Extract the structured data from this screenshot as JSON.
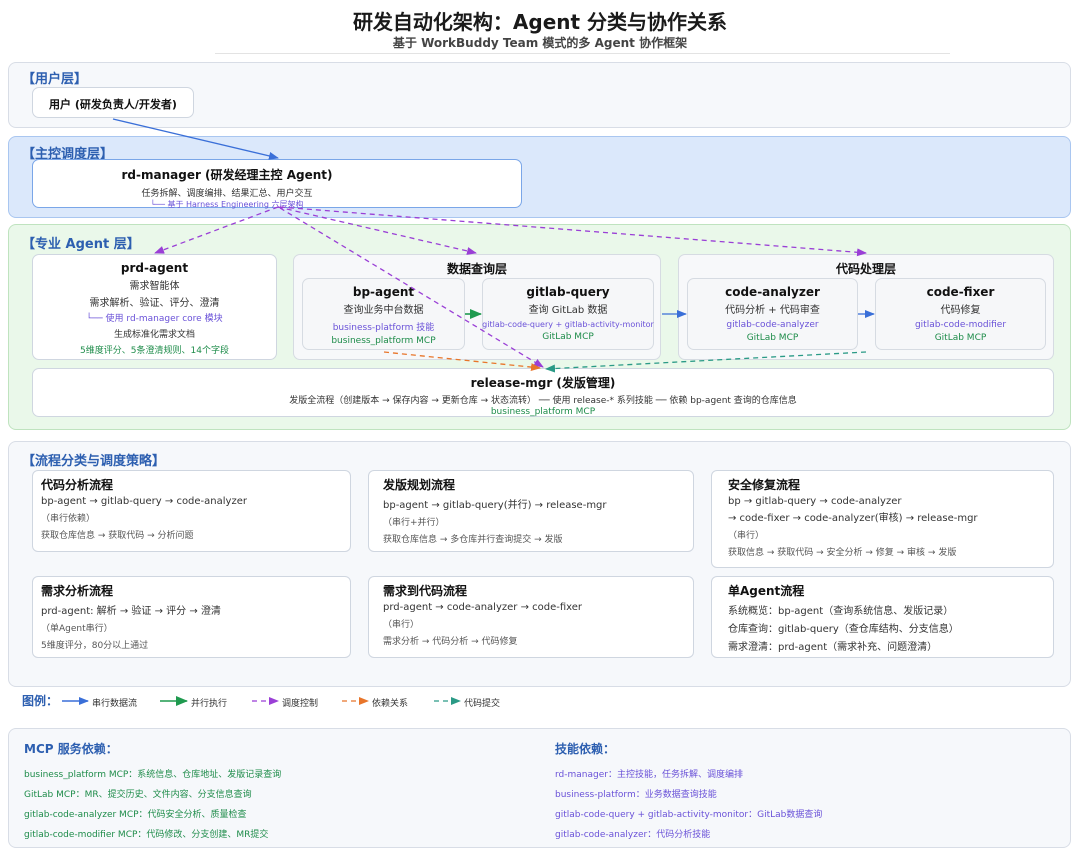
{
  "header": {
    "title": "研发自动化架构：Agent 分类与协作关系",
    "subtitle": "基于 WorkBuddy Team 模式的多 Agent 协作框架"
  },
  "user_layer": {
    "title": "【用户层】",
    "user_box": "用户 (研发负责人/开发者)"
  },
  "main_layer": {
    "title": "【主控调度层】",
    "rd_manager": {
      "name": "rd-manager (研发经理主控 Agent)",
      "desc": "任务拆解、调度编排、结果汇总、用户交互",
      "note": "└── 基于 Harness Engineering 六层架构"
    }
  },
  "agent_layer": {
    "title": "【专业 Agent 层】",
    "prd_agent": {
      "name": "prd-agent",
      "line1": "需求智能体",
      "line2": "需求解析、验证、评分、澄清",
      "line3": "└── 使用 rd-manager core 模块",
      "line4": "生成标准化需求文档",
      "line5": "5维度评分、5条澄清规则、14个字段"
    },
    "data_group": {
      "title": "数据查询层",
      "bp_agent": {
        "name": "bp-agent",
        "desc": "查询业务中台数据",
        "skill": "business-platform 技能",
        "mcp": "business_platform MCP"
      },
      "gitlab_query": {
        "name": "gitlab-query",
        "desc": "查询 GitLab 数据",
        "skill": "gitlab-code-query + gitlab-activity-monitor",
        "mcp": "GitLab MCP"
      }
    },
    "code_group": {
      "title": "代码处理层",
      "code_analyzer": {
        "name": "code-analyzer",
        "desc": "代码分析 + 代码审查",
        "skill": "gitlab-code-analyzer",
        "mcp": "GitLab MCP"
      },
      "code_fixer": {
        "name": "code-fixer",
        "desc": "代码修复",
        "skill": "gitlab-code-modifier",
        "mcp": "GitLab MCP"
      }
    },
    "release_mgr": {
      "name": "release-mgr (发版管理)",
      "desc": "发版全流程（创建版本 → 保存内容 → 更新仓库 → 状态流转） ── 使用 release-* 系列技能 ── 依赖 bp-agent 查询的仓库信息",
      "mcp": "business_platform MCP"
    }
  },
  "flow_layer": {
    "title": "【流程分类与调度策略】",
    "cards": [
      {
        "title": "代码分析流程",
        "lines": [
          "bp-agent → gitlab-query → code-analyzer"
        ],
        "mode": "（串行依赖）",
        "summary": "获取仓库信息 → 获取代码 → 分析问题"
      },
      {
        "title": "发版规划流程",
        "lines": [
          "bp-agent → gitlab-query(并行) → release-mgr"
        ],
        "mode": "（串行+并行）",
        "summary": "获取仓库信息 → 多仓库并行查询提交 → 发版"
      },
      {
        "title": "安全修复流程",
        "lines": [
          "bp → gitlab-query → code-analyzer",
          "→ code-fixer → code-analyzer(审核) → release-mgr"
        ],
        "mode": "（串行）",
        "summary": "获取信息 → 获取代码 → 安全分析 → 修复 → 审核 → 发版"
      },
      {
        "title": "需求分析流程",
        "lines": [
          "prd-agent: 解析 → 验证 → 评分 → 澄清"
        ],
        "mode": "（单Agent串行）",
        "summary": "5维度评分，80分以上通过"
      },
      {
        "title": "需求到代码流程",
        "lines": [
          "prd-agent → code-analyzer → code-fixer"
        ],
        "mode": "（串行）",
        "summary": "需求分析 → 代码分析 → 代码修复"
      },
      {
        "title": "单Agent流程",
        "lines": [
          "系统概览：bp-agent（查询系统信息、发版记录）",
          "仓库查询：gitlab-query（查仓库结构、分支信息）",
          "需求澄清：prd-agent（需求补充、问题澄清）"
        ],
        "mode": "",
        "summary": ""
      }
    ]
  },
  "legend": {
    "title": "图例：",
    "items": [
      {
        "label": "串行数据流",
        "color": "#3a6fd8",
        "style": "solid"
      },
      {
        "label": "并行执行",
        "color": "#1f9a4f",
        "style": "solid"
      },
      {
        "label": "调度控制",
        "color": "#9a3fd6",
        "style": "dashed"
      },
      {
        "label": "依赖关系",
        "color": "#e8752a",
        "style": "dashed"
      },
      {
        "label": "代码提交",
        "color": "#2a9a86",
        "style": "dashed"
      }
    ]
  },
  "dependencies": {
    "mcp_title": "MCP 服务依赖：",
    "mcp_items": [
      "business_platform MCP：系统信息、仓库地址、发版记录查询",
      "GitLab MCP：MR、提交历史、文件内容、分支信息查询",
      "gitlab-code-analyzer MCP：代码安全分析、质量检查",
      "gitlab-code-modifier MCP：代码修改、分支创建、MR提交"
    ],
    "skill_title": "技能依赖：",
    "skill_items": [
      "rd-manager：主控技能，任务拆解、调度编排",
      "business-platform：业务数据查询技能",
      "gitlab-code-query + gitlab-activity-monitor：GitLab数据查询",
      "gitlab-code-analyzer：代码分析技能"
    ]
  },
  "colors": {
    "serial": "#3a6fd8",
    "parallel": "#1f9a4f",
    "control": "#9a3fd6",
    "dependency": "#e8752a",
    "commit": "#2a9a86"
  }
}
